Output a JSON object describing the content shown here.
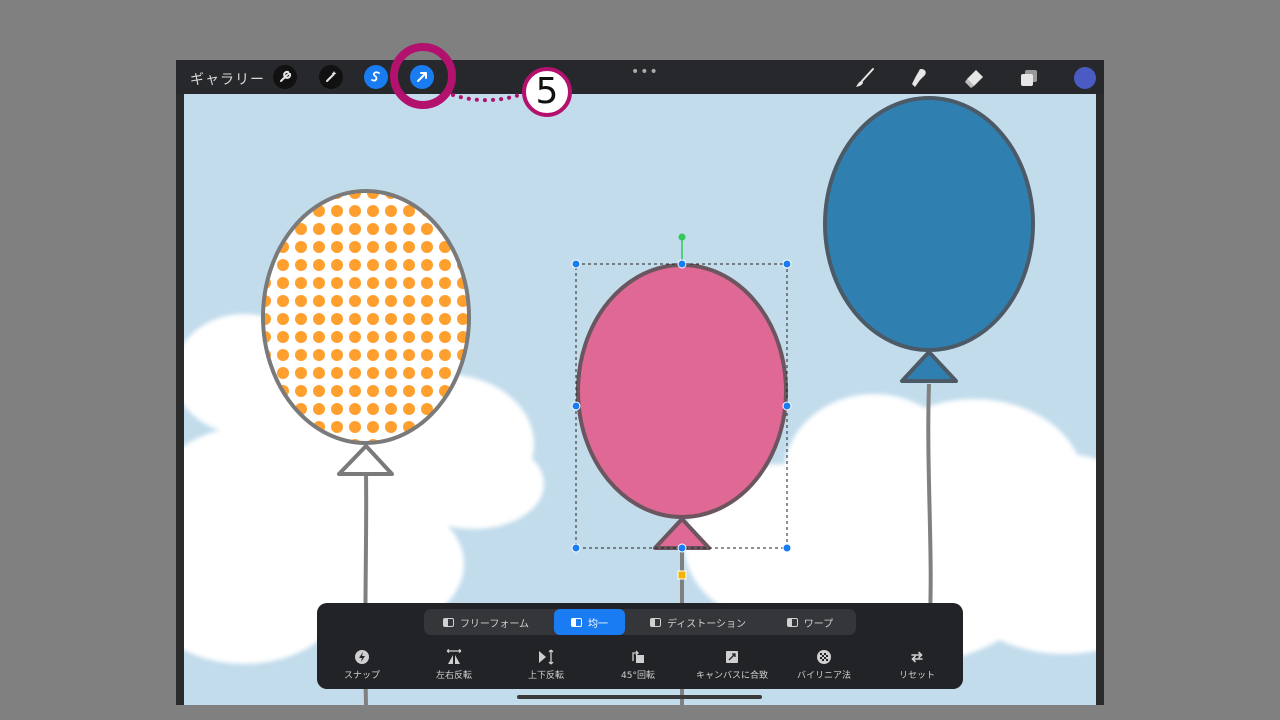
{
  "topbar": {
    "gallery_label": "ギャラリー",
    "more_glyph": "•••",
    "tools_left": [
      {
        "name": "wrench-icon",
        "active": false
      },
      {
        "name": "magic-wand-icon",
        "active": false
      },
      {
        "name": "selection-s-icon",
        "active": true
      },
      {
        "name": "transform-arrow-icon",
        "active": true
      }
    ],
    "tools_right": [
      "brush-icon",
      "smudge-icon",
      "eraser-icon",
      "layers-icon"
    ],
    "color_swatch": "#4a5bc4"
  },
  "callout": {
    "number": "5",
    "color": "#b3116e"
  },
  "canvas": {
    "sky_color": "#c2dcec",
    "balloons": [
      {
        "name": "polka-dot-balloon",
        "fill": "#ff9f2e",
        "pattern": "dots"
      },
      {
        "name": "pink-balloon",
        "fill": "#e06894",
        "selected": true
      },
      {
        "name": "blue-balloon",
        "fill": "#2f80b0"
      }
    ]
  },
  "transform_panel": {
    "modes": [
      {
        "label": "フリーフォーム",
        "active": false
      },
      {
        "label": "均一",
        "active": true
      },
      {
        "label": "ディストーション",
        "active": false
      },
      {
        "label": "ワープ",
        "active": false
      }
    ],
    "actions": [
      {
        "label": "スナップ",
        "icon": "snap-icon"
      },
      {
        "label": "左右反転",
        "icon": "flip-horizontal-icon"
      },
      {
        "label": "上下反転",
        "icon": "flip-vertical-icon"
      },
      {
        "label": "45°回転",
        "icon": "rotate-45-icon"
      },
      {
        "label": "キャンバスに合致",
        "icon": "fit-canvas-icon"
      },
      {
        "label": "バイリニア法",
        "icon": "interpolation-icon"
      },
      {
        "label": "リセット",
        "icon": "reset-icon"
      }
    ]
  }
}
